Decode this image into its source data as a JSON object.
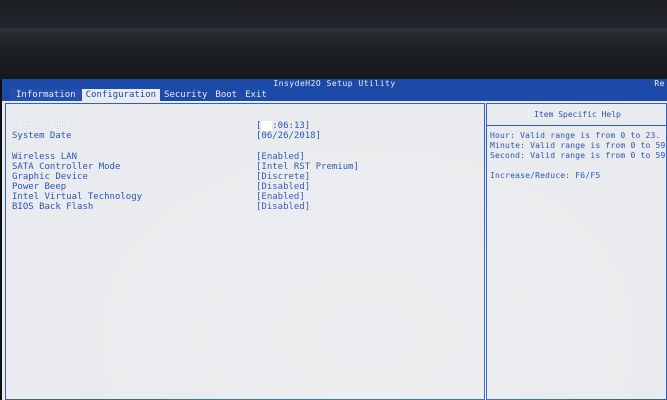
{
  "window": {
    "title": "InsydeH2O Setup Utility",
    "corner_text": "Re"
  },
  "menu": {
    "tabs": [
      {
        "label": "Information"
      },
      {
        "label": "Configuration"
      },
      {
        "label": "Security"
      },
      {
        "label": "Boot"
      },
      {
        "label": "Exit"
      }
    ],
    "active_tab": "Configuration"
  },
  "settings": {
    "time": {
      "label": "System Time",
      "value_cursor": "22",
      "value_rest": ":06:13]",
      "open": "["
    },
    "date": {
      "label": "System Date",
      "value": "[06/26/2018]"
    },
    "items": [
      {
        "label": "Wireless LAN",
        "value": "[Enabled]"
      },
      {
        "label": "SATA Controller Mode",
        "value": "[Intel RST Premium]"
      },
      {
        "label": "Graphic Device",
        "value": "[Discrete]"
      },
      {
        "label": "Power Beep",
        "value": "[Disabled]"
      },
      {
        "label": "Intel Virtual Technology",
        "value": "[Enabled]"
      },
      {
        "label": "BIOS Back Flash",
        "value": "[Disabled]"
      }
    ]
  },
  "help": {
    "title": "Item Specific Help",
    "lines": [
      "Hour: Valid range is from 0 to 23.",
      "Minute: Valid range is from 0 to 59",
      "Second: Valid range is from 0 to 59"
    ],
    "hint": "Increase/Reduce: F6/F5"
  },
  "colors": {
    "accent": "#1c4aa8",
    "text": "#2b55b8",
    "background": "#e9ebee"
  }
}
